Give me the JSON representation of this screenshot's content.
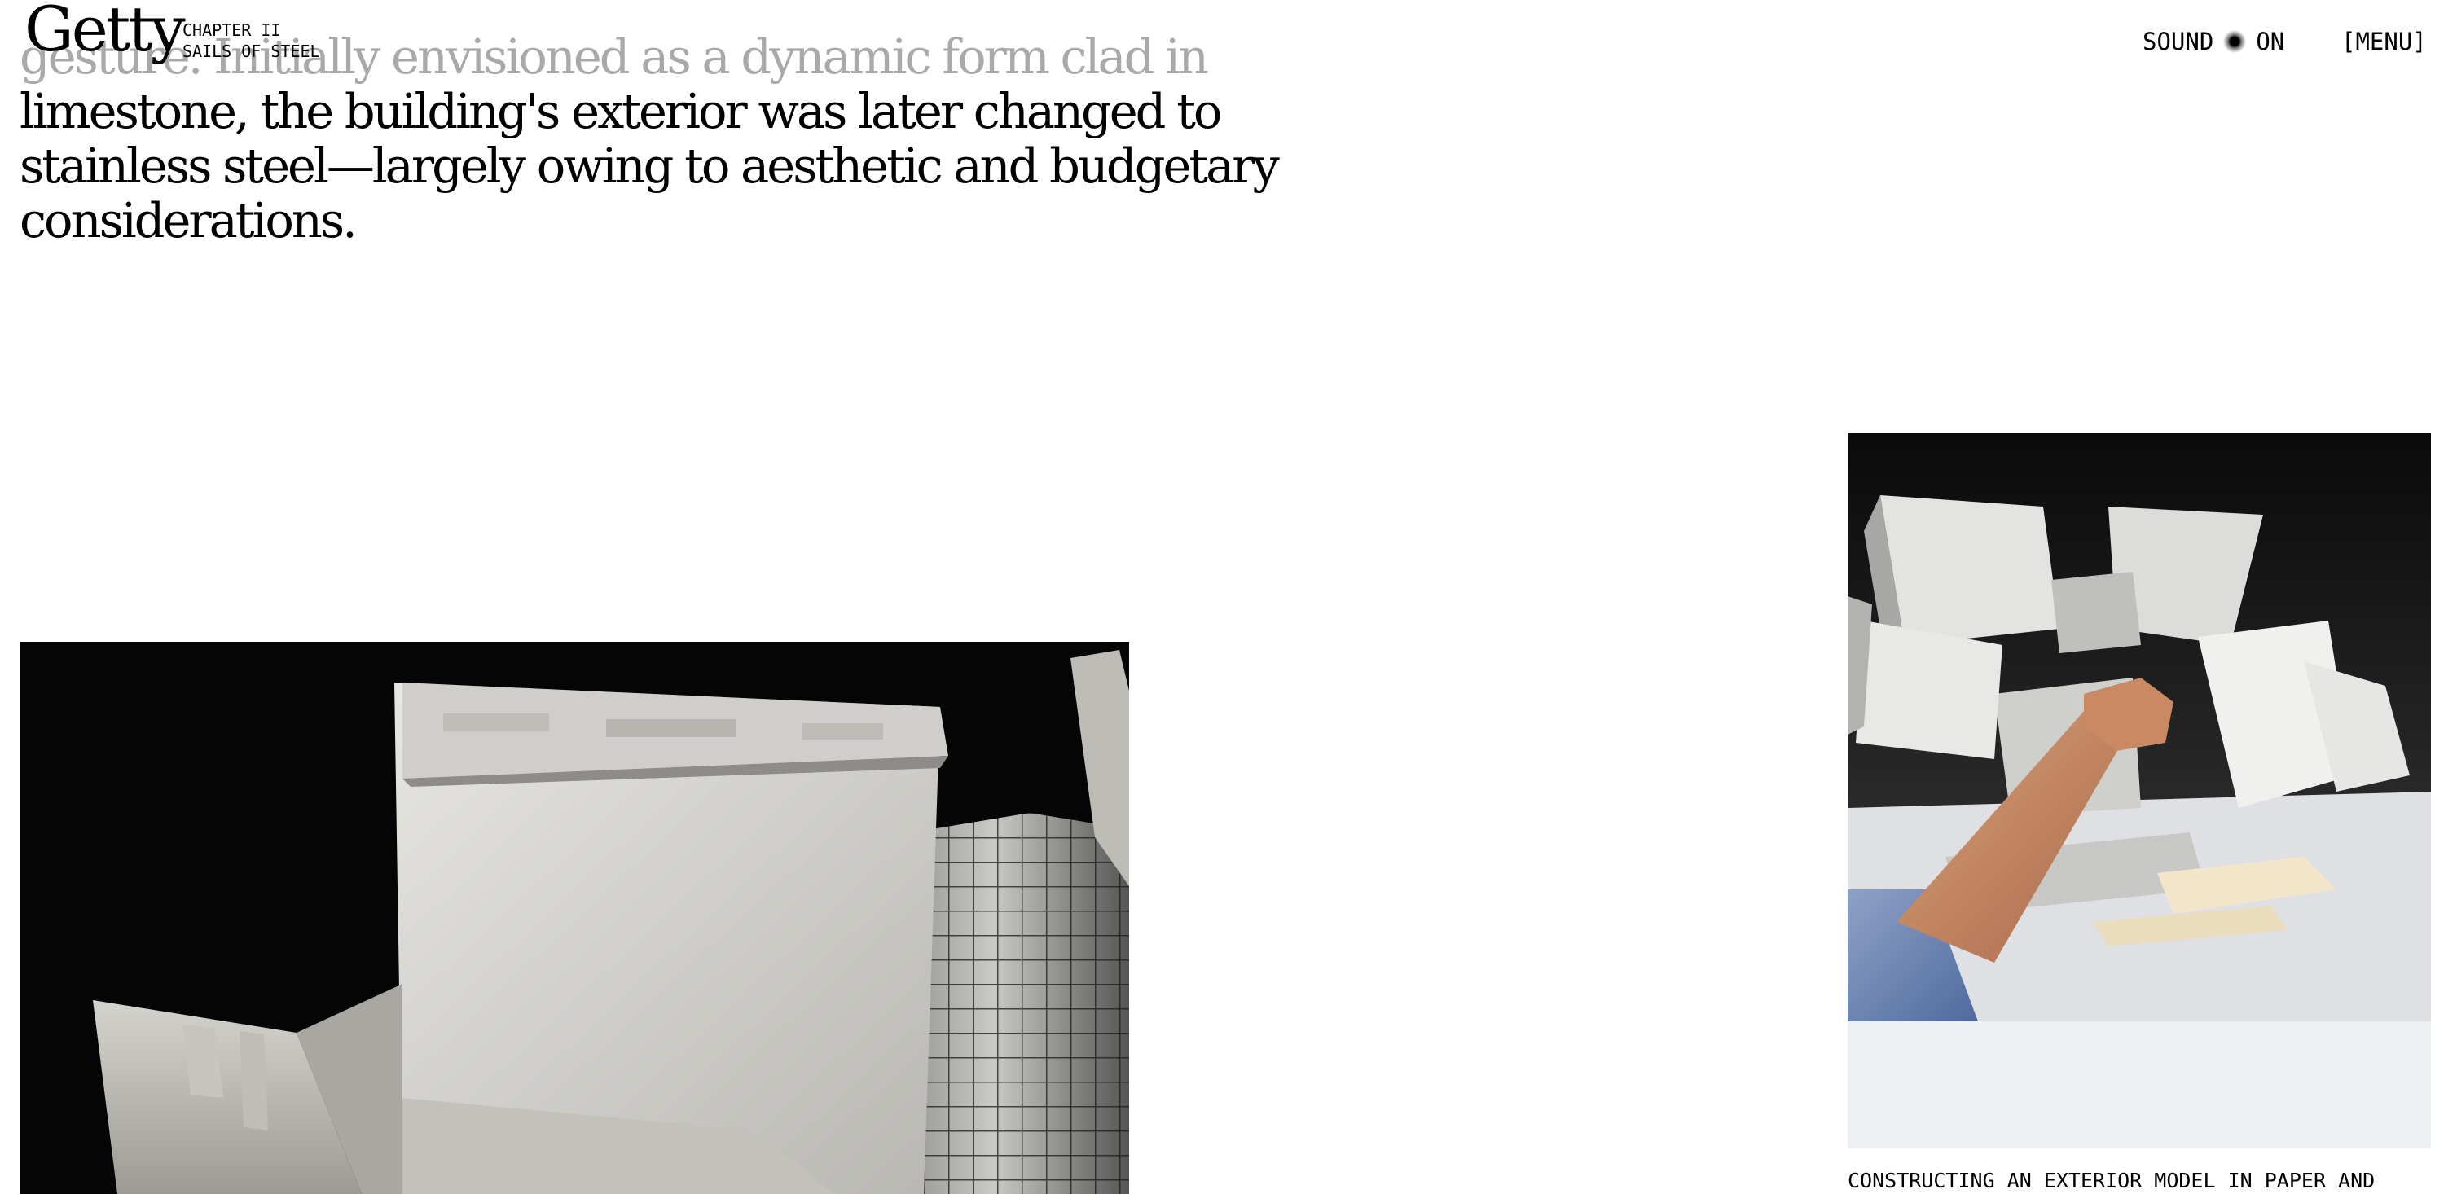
{
  "header": {
    "logo": "Getty",
    "chapter_number": "CHAPTER II",
    "chapter_title": "SAILS OF STEEL",
    "sound_label": "SOUND",
    "sound_state": "ON",
    "menu_label": "[MENU]"
  },
  "article": {
    "lines": [
      "gesture. Initially envisioned as a dynamic form clad in",
      "limestone, the building's exterior was later changed to",
      "stainless steel—largely owing to aesthetic and budgetary",
      "considerations."
    ]
  },
  "figures": {
    "right_caption": "CONSTRUCTING AN EXTERIOR MODEL IN PAPER AND"
  },
  "icons": {
    "sound_indicator": "radio-dot-icon"
  },
  "colors": {
    "text": "#000000",
    "faded_text": "#a9a9a9",
    "background": "#ffffff"
  }
}
